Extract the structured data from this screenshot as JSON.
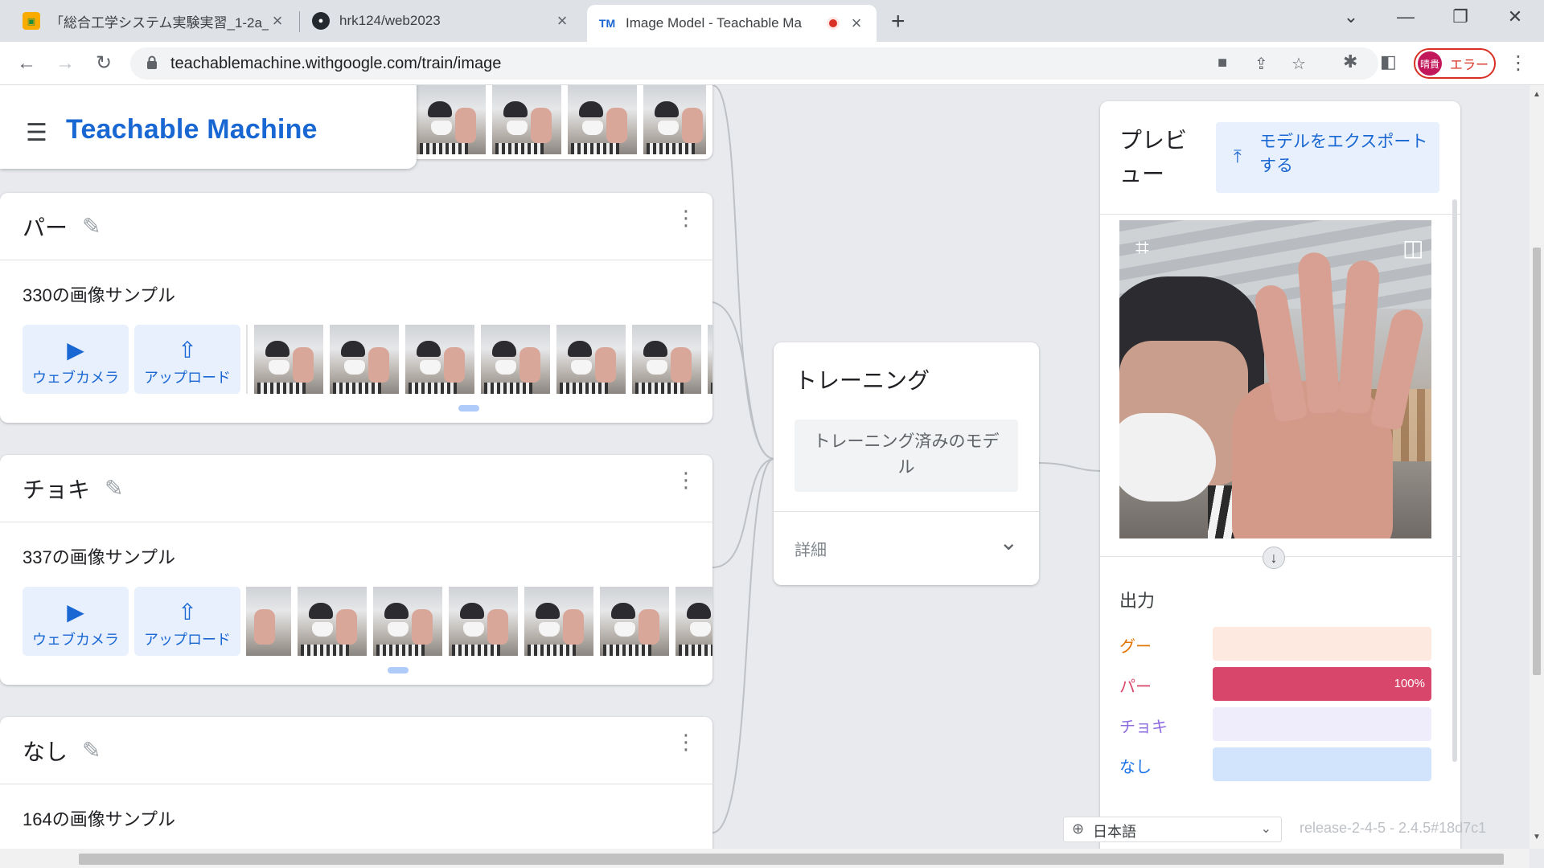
{
  "browser": {
    "tabs": [
      {
        "title": "「総合工学システム実験実習_1-2a_",
        "icon": "classroom-icon"
      },
      {
        "title": "hrk124/web2023",
        "icon": "github-icon"
      },
      {
        "title": "Image Model - Teachable Ma",
        "icon": "tm-icon",
        "recording": true
      }
    ],
    "tm_favicon_text": "TM",
    "url": "teachablemachine.withgoogle.com/train/image",
    "profile_initials": "晴貴",
    "profile_status": "エラー"
  },
  "app": {
    "title": "Teachable Machine"
  },
  "classes": [
    {
      "name": "パー",
      "count": "330",
      "count_suffix": "の画像サンプル",
      "webcam_label": "ウェブカメラ",
      "upload_label": "アップロード"
    },
    {
      "name": "チョキ",
      "count": "337",
      "count_suffix": "の画像サンプル",
      "webcam_label": "ウェブカメラ",
      "upload_label": "アップロード"
    },
    {
      "name": "なし",
      "count": "164",
      "count_suffix": "の画像サンプル"
    }
  ],
  "training": {
    "title": "トレーニング",
    "button_label": "トレーニング済みのモデル",
    "advanced_label": "詳細"
  },
  "preview": {
    "title": "プレビュー",
    "export_label": "モデルをエクスポートする",
    "output_title": "出力",
    "outputs": [
      {
        "label": "グー",
        "value": 0,
        "color": "#e37400",
        "track": "#fde9df",
        "fill": "#e37400",
        "pct": ""
      },
      {
        "label": "パー",
        "value": 1.0,
        "color": "#d9466b",
        "track": "#f8d7df",
        "fill": "#d9466b",
        "pct": "100%"
      },
      {
        "label": "チョキ",
        "value": 0,
        "color": "#8e6ce0",
        "track": "#efedfc",
        "fill": "#8e6ce0",
        "pct": ""
      },
      {
        "label": "なし",
        "value": 0,
        "color": "#1a73e8",
        "track": "#d2e3fc",
        "fill": "#1a73e8",
        "pct": ""
      }
    ]
  },
  "footer": {
    "language": "日本語",
    "version": "release-2-4-5 - 2.4.5#18d7c1"
  },
  "colors": {
    "brand_blue": "#1967d2",
    "record_red": "#d93025"
  }
}
